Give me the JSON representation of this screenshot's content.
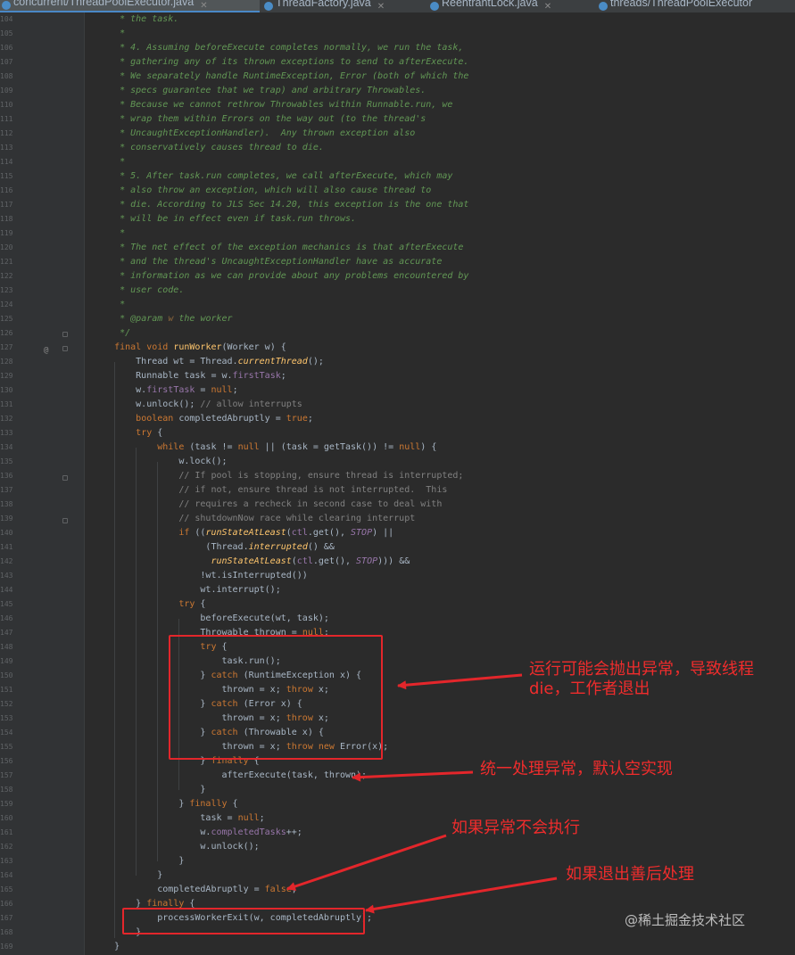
{
  "tabs": [
    {
      "label": "concurrent/ThreadPoolExecutor.java",
      "active": true
    },
    {
      "label": "ThreadFactory.java",
      "active": false
    },
    {
      "label": "ReentrantLock.java",
      "active": false
    },
    {
      "label": "threads/ThreadPoolExecutor",
      "active": false
    }
  ],
  "code_lines": [
    {
      "n": "104",
      "segs": [
        [
          "     * the task.",
          "cmt"
        ]
      ]
    },
    {
      "n": "105",
      "segs": [
        [
          "     *",
          "cmt"
        ]
      ]
    },
    {
      "n": "106",
      "segs": [
        [
          "     * 4. Assuming beforeExecute completes normally, we run the task,",
          "cmt"
        ]
      ]
    },
    {
      "n": "107",
      "segs": [
        [
          "     * gathering any of its thrown exceptions to send to afterExecute.",
          "cmt"
        ]
      ]
    },
    {
      "n": "108",
      "segs": [
        [
          "     * We separately handle RuntimeException, Error (both of which the",
          "cmt"
        ]
      ]
    },
    {
      "n": "109",
      "segs": [
        [
          "     * specs guarantee that we trap) and arbitrary Throwables.",
          "cmt"
        ]
      ]
    },
    {
      "n": "110",
      "segs": [
        [
          "     * Because we cannot rethrow Throwables within Runnable.run, we",
          "cmt"
        ]
      ]
    },
    {
      "n": "111",
      "segs": [
        [
          "     * wrap them within Errors on the way out (to the thread's",
          "cmt"
        ]
      ]
    },
    {
      "n": "112",
      "segs": [
        [
          "     * UncaughtExceptionHandler).  Any thrown exception also",
          "cmt"
        ]
      ]
    },
    {
      "n": "113",
      "segs": [
        [
          "     * conservatively causes thread to die.",
          "cmt"
        ]
      ]
    },
    {
      "n": "114",
      "segs": [
        [
          "     *",
          "cmt"
        ]
      ]
    },
    {
      "n": "115",
      "segs": [
        [
          "     * 5. After task.run completes, we call afterExecute, which may",
          "cmt"
        ]
      ]
    },
    {
      "n": "116",
      "segs": [
        [
          "     * also throw an exception, which will also cause thread to",
          "cmt"
        ]
      ]
    },
    {
      "n": "117",
      "segs": [
        [
          "     * die. According to JLS Sec 14.20, this exception is the one that",
          "cmt"
        ]
      ]
    },
    {
      "n": "118",
      "segs": [
        [
          "     * will be in effect even if task.run throws.",
          "cmt"
        ]
      ]
    },
    {
      "n": "119",
      "segs": [
        [
          "     *",
          "cmt"
        ]
      ]
    },
    {
      "n": "120",
      "segs": [
        [
          "     * The net effect of the exception mechanics is that afterExecute",
          "cmt"
        ]
      ]
    },
    {
      "n": "121",
      "segs": [
        [
          "     * and the thread's UncaughtExceptionHandler have as accurate",
          "cmt"
        ]
      ]
    },
    {
      "n": "122",
      "segs": [
        [
          "     * information as we can provide about any problems encountered by",
          "cmt"
        ]
      ]
    },
    {
      "n": "123",
      "segs": [
        [
          "     * user code.",
          "cmt"
        ]
      ]
    },
    {
      "n": "124",
      "segs": [
        [
          "     *",
          "cmt"
        ]
      ]
    },
    {
      "n": "125",
      "segs": [
        [
          "     * ",
          "cmt"
        ],
        [
          "@param",
          "tag"
        ],
        [
          " ",
          "cmt"
        ],
        [
          "w",
          "param"
        ],
        [
          " the worker",
          "cmt"
        ]
      ]
    },
    {
      "n": "126",
      "segs": [
        [
          "     */",
          "cmt"
        ]
      ]
    },
    {
      "n": "127",
      "segs": [
        [
          "    ",
          ""
        ],
        [
          "final void ",
          "kw"
        ],
        [
          "runWorker",
          "fn"
        ],
        [
          "(Worker w) {",
          ""
        ]
      ]
    },
    {
      "n": "128",
      "segs": [
        [
          "        Thread wt = Thread.",
          ""
        ],
        [
          "currentThread",
          "sfn"
        ],
        [
          "();",
          ""
        ]
      ]
    },
    {
      "n": "129",
      "segs": [
        [
          "        Runnable task = w.",
          ""
        ],
        [
          "firstTask",
          "fld"
        ],
        [
          ";",
          ""
        ]
      ]
    },
    {
      "n": "130",
      "segs": [
        [
          "        w.",
          ""
        ],
        [
          "firstTask",
          "fld"
        ],
        [
          " = ",
          ""
        ],
        [
          "null",
          "kw"
        ],
        [
          ";",
          ""
        ]
      ]
    },
    {
      "n": "131",
      "segs": [
        [
          "        w.unlock(); ",
          ""
        ],
        [
          "// allow interrupts",
          "ccmt"
        ]
      ]
    },
    {
      "n": "132",
      "segs": [
        [
          "        ",
          ""
        ],
        [
          "boolean ",
          "kw"
        ],
        [
          "completedAbruptly = ",
          ""
        ],
        [
          "true",
          "kw"
        ],
        [
          ";",
          ""
        ]
      ]
    },
    {
      "n": "133",
      "segs": [
        [
          "        ",
          ""
        ],
        [
          "try ",
          "kw"
        ],
        [
          "{",
          ""
        ]
      ]
    },
    {
      "n": "134",
      "segs": [
        [
          "            ",
          ""
        ],
        [
          "while ",
          "kw"
        ],
        [
          "(task != ",
          ""
        ],
        [
          "null ",
          "kw"
        ],
        [
          "|| (task = getTask()) != ",
          ""
        ],
        [
          "null",
          "kw"
        ],
        [
          ") {",
          ""
        ]
      ]
    },
    {
      "n": "135",
      "segs": [
        [
          "                w.lock();",
          ""
        ]
      ]
    },
    {
      "n": "136",
      "segs": [
        [
          "                // If pool is stopping, ensure thread is interrupted;",
          "ccmt"
        ]
      ]
    },
    {
      "n": "137",
      "segs": [
        [
          "                // if not, ensure thread is not interrupted.  This",
          "ccmt"
        ]
      ]
    },
    {
      "n": "138",
      "segs": [
        [
          "                // requires a recheck in second case to deal with",
          "ccmt"
        ]
      ]
    },
    {
      "n": "139",
      "segs": [
        [
          "                // shutdownNow race while clearing interrupt",
          "ccmt"
        ]
      ]
    },
    {
      "n": "140",
      "segs": [
        [
          "                ",
          ""
        ],
        [
          "if ",
          "kw"
        ],
        [
          "((",
          ""
        ],
        [
          "runStateAtLeast",
          "sfn"
        ],
        [
          "(",
          ""
        ],
        [
          "ctl",
          "fld"
        ],
        [
          ".get(), ",
          ""
        ],
        [
          "STOP",
          "const"
        ],
        [
          ") ||",
          ""
        ]
      ]
    },
    {
      "n": "141",
      "segs": [
        [
          "                     (Thread.",
          ""
        ],
        [
          "interrupted",
          "sfn"
        ],
        [
          "() &&",
          ""
        ]
      ]
    },
    {
      "n": "142",
      "segs": [
        [
          "                      ",
          ""
        ],
        [
          "runStateAtLeast",
          "sfn"
        ],
        [
          "(",
          ""
        ],
        [
          "ctl",
          "fld"
        ],
        [
          ".get(), ",
          ""
        ],
        [
          "STOP",
          "const"
        ],
        [
          "))) &&",
          ""
        ]
      ]
    },
    {
      "n": "143",
      "segs": [
        [
          "                    !wt.isInterrupted())",
          ""
        ]
      ]
    },
    {
      "n": "144",
      "segs": [
        [
          "                    wt.interrupt();",
          ""
        ]
      ]
    },
    {
      "n": "145",
      "segs": [
        [
          "                ",
          ""
        ],
        [
          "try ",
          "kw"
        ],
        [
          "{",
          ""
        ]
      ]
    },
    {
      "n": "146",
      "segs": [
        [
          "                    beforeExecute(wt, task);",
          ""
        ]
      ]
    },
    {
      "n": "147",
      "segs": [
        [
          "                    Throwable thrown = ",
          ""
        ],
        [
          "null",
          "kw"
        ],
        [
          ";",
          ""
        ]
      ]
    },
    {
      "n": "148",
      "segs": [
        [
          "                    ",
          ""
        ],
        [
          "try ",
          "kw"
        ],
        [
          "{",
          ""
        ]
      ]
    },
    {
      "n": "149",
      "segs": [
        [
          "                        task.run();",
          ""
        ]
      ]
    },
    {
      "n": "150",
      "segs": [
        [
          "                    } ",
          ""
        ],
        [
          "catch ",
          "kw"
        ],
        [
          "(RuntimeException x) {",
          ""
        ]
      ]
    },
    {
      "n": "151",
      "segs": [
        [
          "                        thrown = x; ",
          ""
        ],
        [
          "throw ",
          "kw"
        ],
        [
          "x;",
          ""
        ]
      ]
    },
    {
      "n": "152",
      "segs": [
        [
          "                    } ",
          ""
        ],
        [
          "catch ",
          "kw"
        ],
        [
          "(Error x) {",
          ""
        ]
      ]
    },
    {
      "n": "153",
      "segs": [
        [
          "                        thrown = x; ",
          ""
        ],
        [
          "throw ",
          "kw"
        ],
        [
          "x;",
          ""
        ]
      ]
    },
    {
      "n": "154",
      "segs": [
        [
          "                    } ",
          ""
        ],
        [
          "catch ",
          "kw"
        ],
        [
          "(Throwable x) {",
          ""
        ]
      ]
    },
    {
      "n": "155",
      "segs": [
        [
          "                        thrown = x; ",
          ""
        ],
        [
          "throw new ",
          "kw"
        ],
        [
          "Error(x);",
          ""
        ]
      ]
    },
    {
      "n": "156",
      "segs": [
        [
          "                    } ",
          ""
        ],
        [
          "finally ",
          "kw"
        ],
        [
          "{",
          ""
        ]
      ]
    },
    {
      "n": "157",
      "segs": [
        [
          "                        afterExecute(task, thrown);",
          ""
        ]
      ]
    },
    {
      "n": "158",
      "segs": [
        [
          "                    }",
          ""
        ]
      ]
    },
    {
      "n": "159",
      "segs": [
        [
          "                } ",
          ""
        ],
        [
          "finally ",
          "kw"
        ],
        [
          "{",
          ""
        ]
      ]
    },
    {
      "n": "160",
      "segs": [
        [
          "                    task = ",
          ""
        ],
        [
          "null",
          "kw"
        ],
        [
          ";",
          ""
        ]
      ]
    },
    {
      "n": "161",
      "segs": [
        [
          "                    w.",
          ""
        ],
        [
          "completedTasks",
          "fld"
        ],
        [
          "++;",
          ""
        ]
      ]
    },
    {
      "n": "162",
      "segs": [
        [
          "                    w.unlock();",
          ""
        ]
      ]
    },
    {
      "n": "163",
      "segs": [
        [
          "                }",
          ""
        ]
      ]
    },
    {
      "n": "164",
      "segs": [
        [
          "            }",
          ""
        ]
      ]
    },
    {
      "n": "165",
      "segs": [
        [
          "            completedAbruptly = ",
          ""
        ],
        [
          "false",
          "kw"
        ],
        [
          ";",
          ""
        ]
      ]
    },
    {
      "n": "166",
      "segs": [
        [
          "        } ",
          ""
        ],
        [
          "finally ",
          "kw"
        ],
        [
          "{",
          ""
        ]
      ]
    },
    {
      "n": "167",
      "segs": [
        [
          "            processWorkerExit(w, completedAbruptly);",
          ""
        ]
      ]
    },
    {
      "n": "168",
      "segs": [
        [
          "        }",
          ""
        ]
      ]
    },
    {
      "n": "169",
      "segs": [
        [
          "    }",
          ""
        ]
      ]
    }
  ],
  "annotations": {
    "a1_line1": "运行可能会抛出异常，导致线程",
    "a1_line2": "die，工作者退出",
    "a2": "统一处理异常，默认空实现",
    "a3": "如果异常不会执行",
    "a4": "如果退出善后处理"
  },
  "override_marker": "@",
  "watermark": "@稀土掘金技术社区",
  "colors": {
    "background": "#2b2b2b",
    "keyword": "#cc7832",
    "method": "#ffc66d",
    "field": "#9876aa",
    "doc_comment": "#629755",
    "line_comment": "#808080",
    "annotation_red": "#e3262b"
  }
}
